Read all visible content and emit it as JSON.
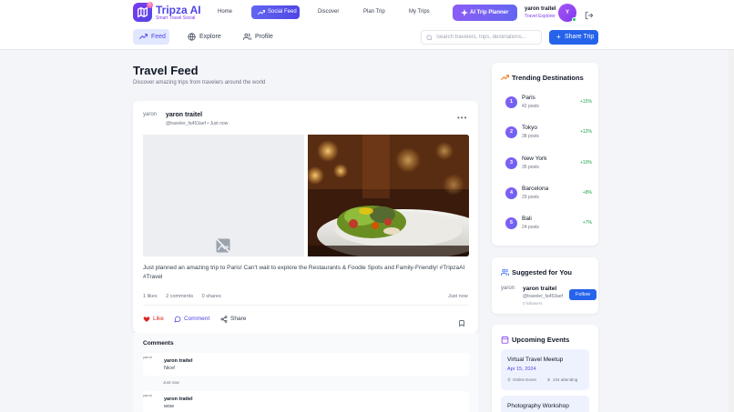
{
  "brand": {
    "name": "Tripza AI",
    "subtitle": "Smart Travel Social",
    "badge": "5"
  },
  "nav": {
    "links": [
      "Home",
      "Social Feed",
      "Discover",
      "Plan Trip",
      "My Trips"
    ],
    "active": "Social Feed",
    "ai_button": "AI Trip Planner"
  },
  "user": {
    "name": "yaron traitel",
    "role": "Travel Explorer",
    "initial": "Y"
  },
  "subnav": {
    "tabs": [
      "Feed",
      "Explore",
      "Profile"
    ],
    "active": "Feed",
    "search_placeholder": "Search travelers, trips, destinations...",
    "share_button": "Share Trip"
  },
  "page": {
    "title": "Travel Feed",
    "subtitle": "Discover amazing trips from travelers around the world"
  },
  "post": {
    "avatar_alt": "yaron",
    "author": "yaron traitel",
    "meta": "@traveler_fa453aef • Just now",
    "more": "•••",
    "text": "Just planned an amazing trip to Paris! Can't wait to explore the Restaurants & Foodie Spots and Family-Friendly! #TripzaAI #Travel",
    "likes": "1 likes",
    "comments_count": "2 comments",
    "shares": "0 shares",
    "time": "Just now",
    "actions": {
      "like": "Like",
      "comment": "Comment",
      "share": "Share"
    }
  },
  "comments": {
    "title": "Comments",
    "items": [
      {
        "avatar_alt": "yaron",
        "name": "yaron traitel",
        "text": "Nice!",
        "time": "Just now"
      },
      {
        "avatar_alt": "yaron",
        "name": "yaron traitel",
        "text": "wow",
        "time": ""
      }
    ]
  },
  "trending": {
    "title": "Trending Destinations",
    "items": [
      {
        "rank": "1",
        "name": "Paris",
        "posts": "42 posts",
        "trend": "+15%"
      },
      {
        "rank": "2",
        "name": "Tokyo",
        "posts": "38 posts",
        "trend": "+12%"
      },
      {
        "rank": "3",
        "name": "New York",
        "posts": "35 posts",
        "trend": "+10%"
      },
      {
        "rank": "4",
        "name": "Barcelona",
        "posts": "29 posts",
        "trend": "+8%"
      },
      {
        "rank": "5",
        "name": "Bali",
        "posts": "24 posts",
        "trend": "+7%"
      }
    ]
  },
  "suggested": {
    "title": "Suggested for You",
    "avatar_alt": "yaron",
    "name": "yaron traitel",
    "handle": "@traveler_fa453aef",
    "followers": "0 followers",
    "follow_button": "Follow"
  },
  "events": {
    "title": "Upcoming Events",
    "items": [
      {
        "title": "Virtual Travel Meetup",
        "date": "Apr 15, 2024",
        "location": "Online Event",
        "attending": "234 attending"
      },
      {
        "title": "Photography Workshop",
        "date": "",
        "location": "",
        "attending": ""
      }
    ]
  },
  "colors": {
    "primary": "#4f46e5",
    "accent": "#7c3aed",
    "blue": "#2563eb",
    "like": "#dc2626",
    "trend_up": "#16a34a"
  }
}
